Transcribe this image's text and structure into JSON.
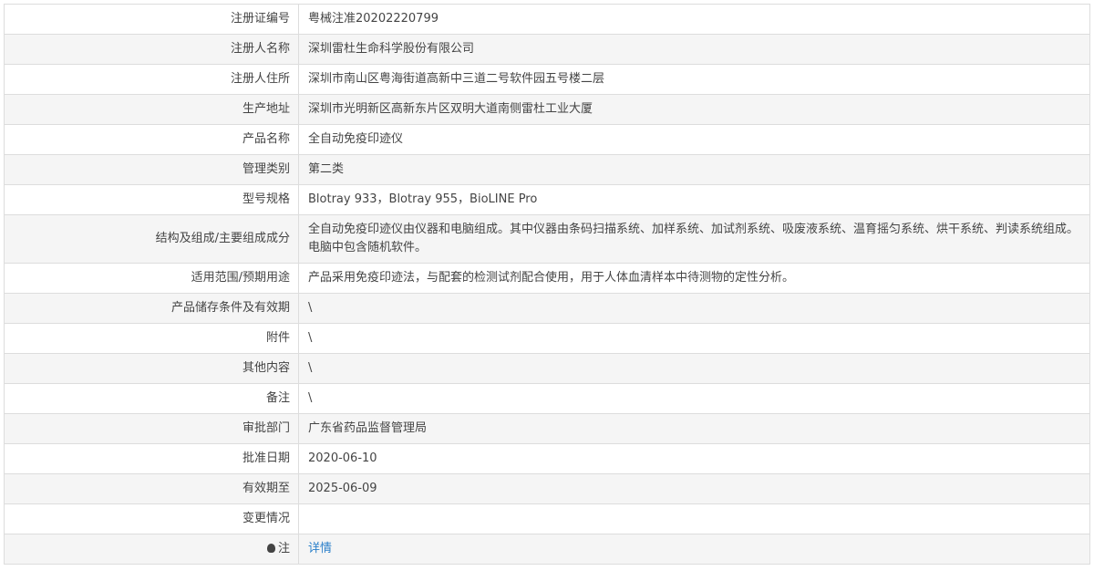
{
  "rows": [
    {
      "label": "注册证编号",
      "value": "粤械注准20202220799"
    },
    {
      "label": "注册人名称",
      "value": "深圳雷杜生命科学股份有限公司"
    },
    {
      "label": "注册人住所",
      "value": "深圳市南山区粤海街道高新中三道二号软件园五号楼二层"
    },
    {
      "label": "生产地址",
      "value": "深圳市光明新区高新东片区双明大道南侧雷杜工业大厦"
    },
    {
      "label": "产品名称",
      "value": "全自动免疫印迹仪"
    },
    {
      "label": "管理类别",
      "value": "第二类"
    },
    {
      "label": "型号规格",
      "value": "Blotray 933，Blotray 955，BioLINE Pro"
    },
    {
      "label": "结构及组成/主要组成成分",
      "value": "全自动免疫印迹仪由仪器和电脑组成。其中仪器由条码扫描系统、加样系统、加试剂系统、吸废液系统、温育摇匀系统、烘干系统、判读系统组成。电脑中包含随机软件。"
    },
    {
      "label": "适用范围/预期用途",
      "value": "产品采用免疫印迹法，与配套的检测试剂配合使用，用于人体血清样本中待测物的定性分析。"
    },
    {
      "label": "产品储存条件及有效期",
      "value": "\\"
    },
    {
      "label": "附件",
      "value": "\\"
    },
    {
      "label": "其他内容",
      "value": "\\"
    },
    {
      "label": "备注",
      "value": "\\"
    },
    {
      "label": "审批部门",
      "value": "广东省药品监督管理局"
    },
    {
      "label": "批准日期",
      "value": "2020-06-10"
    },
    {
      "label": "有效期至",
      "value": "2025-06-09"
    },
    {
      "label": "变更情况",
      "value": ""
    }
  ],
  "note": {
    "label": "注",
    "link": "详情",
    "icon": "lightbulb-icon"
  }
}
